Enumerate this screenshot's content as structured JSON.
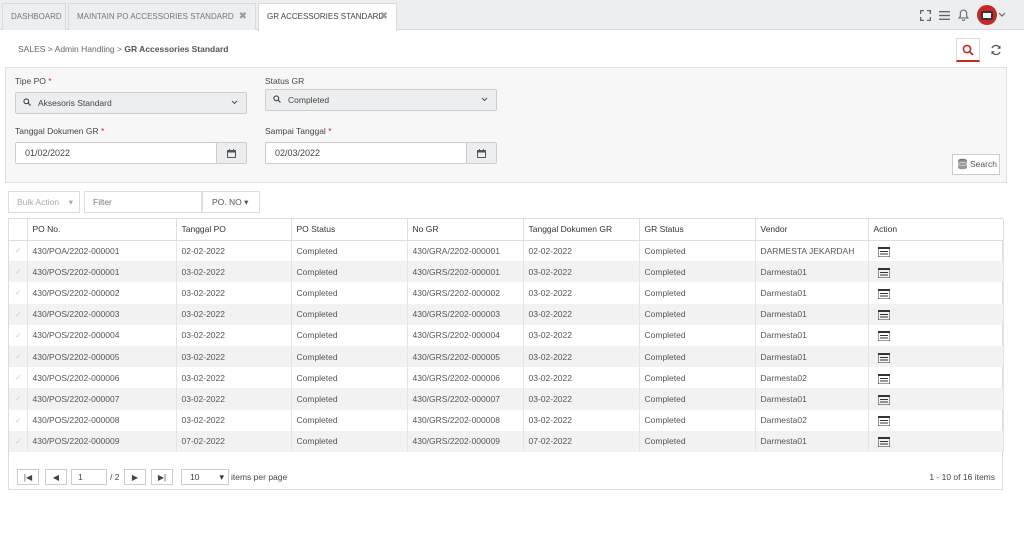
{
  "tabs": [
    {
      "label": "DASHBOARD",
      "closable": false
    },
    {
      "label": "MAINTAIN PO ACCESSORIES STANDARD",
      "closable": true
    },
    {
      "label": "GR ACCESSORIES STANDARD",
      "closable": true,
      "active": true
    }
  ],
  "icons": {
    "close": "✖",
    "expand": "expand-icon",
    "menu": "menu-icon",
    "bell": "bell-icon",
    "avatar": "avatar-icon",
    "chevron": "chevron-down-icon"
  },
  "breadcrumb": {
    "part1": "SALES",
    "sep": ">",
    "part2": "Admin Handling",
    "part3": "GR Accessories Standard"
  },
  "filters": {
    "tipe_po": {
      "label": "Tipe PO",
      "required": "*",
      "value": "Aksesoris Standard"
    },
    "status_gr": {
      "label": "Status GR",
      "value": "Completed"
    },
    "tanggal_dokumen": {
      "label": "Tanggal Dokumen GR",
      "required": "*",
      "value": "01/02/2022"
    },
    "sampai_tanggal": {
      "label": "Sampai Tanggal",
      "required": "*",
      "value": "02/03/2022"
    },
    "search_label": "Search"
  },
  "toolbar": {
    "bulk_action": "Bulk Action",
    "filter_placeholder": "Filter",
    "filter_field": "PO. NO"
  },
  "table": {
    "columns": [
      "PO No.",
      "Tanggal PO",
      "PO Status",
      "No GR",
      "Tanggal Dokumen GR",
      "GR Status",
      "Vendor",
      "Action"
    ],
    "rows": [
      [
        "430/POA/2202-000001",
        "02-02-2022",
        "Completed",
        "430/GRA/2202-000001",
        "02-02-2022",
        "Completed",
        "DARMESTA JEKARDAH"
      ],
      [
        "430/POS/2202-000001",
        "03-02-2022",
        "Completed",
        "430/GRS/2202-000001",
        "03-02-2022",
        "Completed",
        "Darmesta01"
      ],
      [
        "430/POS/2202-000002",
        "03-02-2022",
        "Completed",
        "430/GRS/2202-000002",
        "03-02-2022",
        "Completed",
        "Darmesta01"
      ],
      [
        "430/POS/2202-000003",
        "03-02-2022",
        "Completed",
        "430/GRS/2202-000003",
        "03-02-2022",
        "Completed",
        "Darmesta01"
      ],
      [
        "430/POS/2202-000004",
        "03-02-2022",
        "Completed",
        "430/GRS/2202-000004",
        "03-02-2022",
        "Completed",
        "Darmesta01"
      ],
      [
        "430/POS/2202-000005",
        "03-02-2022",
        "Completed",
        "430/GRS/2202-000005",
        "03-02-2022",
        "Completed",
        "Darmesta01"
      ],
      [
        "430/POS/2202-000006",
        "03-02-2022",
        "Completed",
        "430/GRS/2202-000006",
        "03-02-2022",
        "Completed",
        "Darmesta02"
      ],
      [
        "430/POS/2202-000007",
        "03-02-2022",
        "Completed",
        "430/GRS/2202-000007",
        "03-02-2022",
        "Completed",
        "Darmesta01"
      ],
      [
        "430/POS/2202-000008",
        "03-02-2022",
        "Completed",
        "430/GRS/2202-000008",
        "03-02-2022",
        "Completed",
        "Darmesta02"
      ],
      [
        "430/POS/2202-000009",
        "07-02-2022",
        "Completed",
        "430/GRS/2202-000009",
        "07-02-2022",
        "Completed",
        "Darmesta01"
      ]
    ]
  },
  "pager": {
    "page": "1",
    "of": "/ 2",
    "page_size": "10",
    "per_page_label": "items per page",
    "info": "1 - 10 of 16 items"
  },
  "colors": {
    "accent": "#c62828",
    "panel": "#f7f7f7"
  }
}
